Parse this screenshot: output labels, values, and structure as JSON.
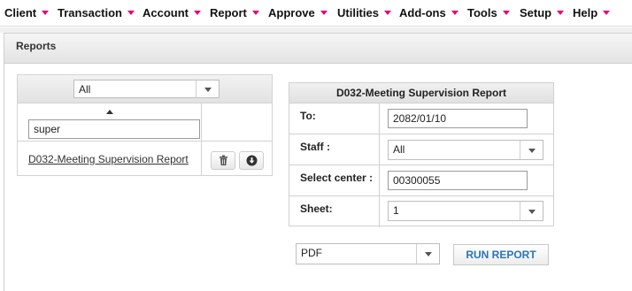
{
  "menu": {
    "items": [
      {
        "label": "Client"
      },
      {
        "label": "Transaction"
      },
      {
        "label": "Account"
      },
      {
        "label": "Report"
      },
      {
        "label": "Approve"
      },
      {
        "label": "Utilities"
      },
      {
        "label": "Add-ons"
      },
      {
        "label": "Tools"
      },
      {
        "label": "Setup"
      },
      {
        "label": "Help"
      }
    ],
    "caret_color": "#e4007c"
  },
  "panel": {
    "title": "Reports"
  },
  "report_list": {
    "category_filter": "All",
    "search_value": "super",
    "rows": [
      {
        "name": "D032-Meeting Supervision Report",
        "actions": [
          {
            "icon": "trash-icon"
          },
          {
            "icon": "download-icon"
          }
        ]
      }
    ]
  },
  "form": {
    "title": "D032-Meeting Supervision Report",
    "fields": {
      "to": {
        "label": "To:",
        "value": "2082/01/10"
      },
      "staff": {
        "label": "Staff :",
        "value": "All"
      },
      "center": {
        "label": "Select center :",
        "value": "00300055"
      },
      "sheet": {
        "label": "Sheet:",
        "value": "1"
      }
    }
  },
  "output": {
    "format": "PDF",
    "run_label": "RUN REPORT",
    "run_color": "#2a74b5"
  }
}
